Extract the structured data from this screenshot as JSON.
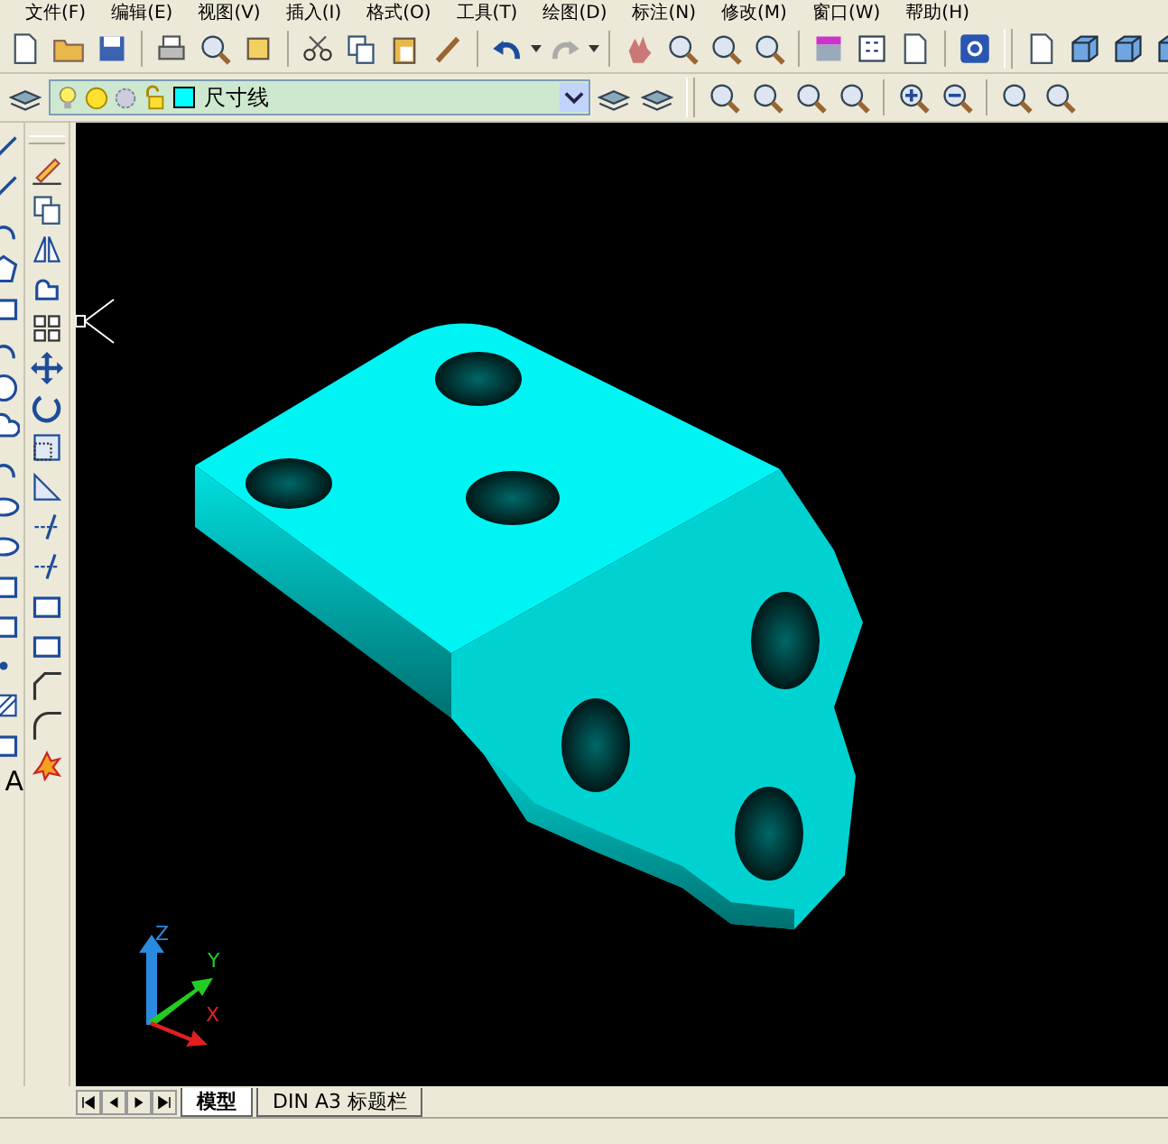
{
  "menu_bar": [
    "文件(F)",
    "编辑(E)",
    "视图(V)",
    "插入(I)",
    "格式(O)",
    "工具(T)",
    "绘图(D)",
    "标注(N)",
    "修改(M)",
    "窗口(W)",
    "帮助(H)"
  ],
  "layer_dropdown": {
    "value": "尺寸线",
    "color": "#00ffff"
  },
  "draw_toolbar": {
    "text_tool_glyph": "A"
  },
  "ucs_axes": {
    "z": "Z",
    "y": "Y",
    "x": "X"
  },
  "layout_tabs": [
    {
      "label": "模型",
      "selected": true
    },
    {
      "label": "DIN A3 标题栏",
      "selected": false
    }
  ]
}
